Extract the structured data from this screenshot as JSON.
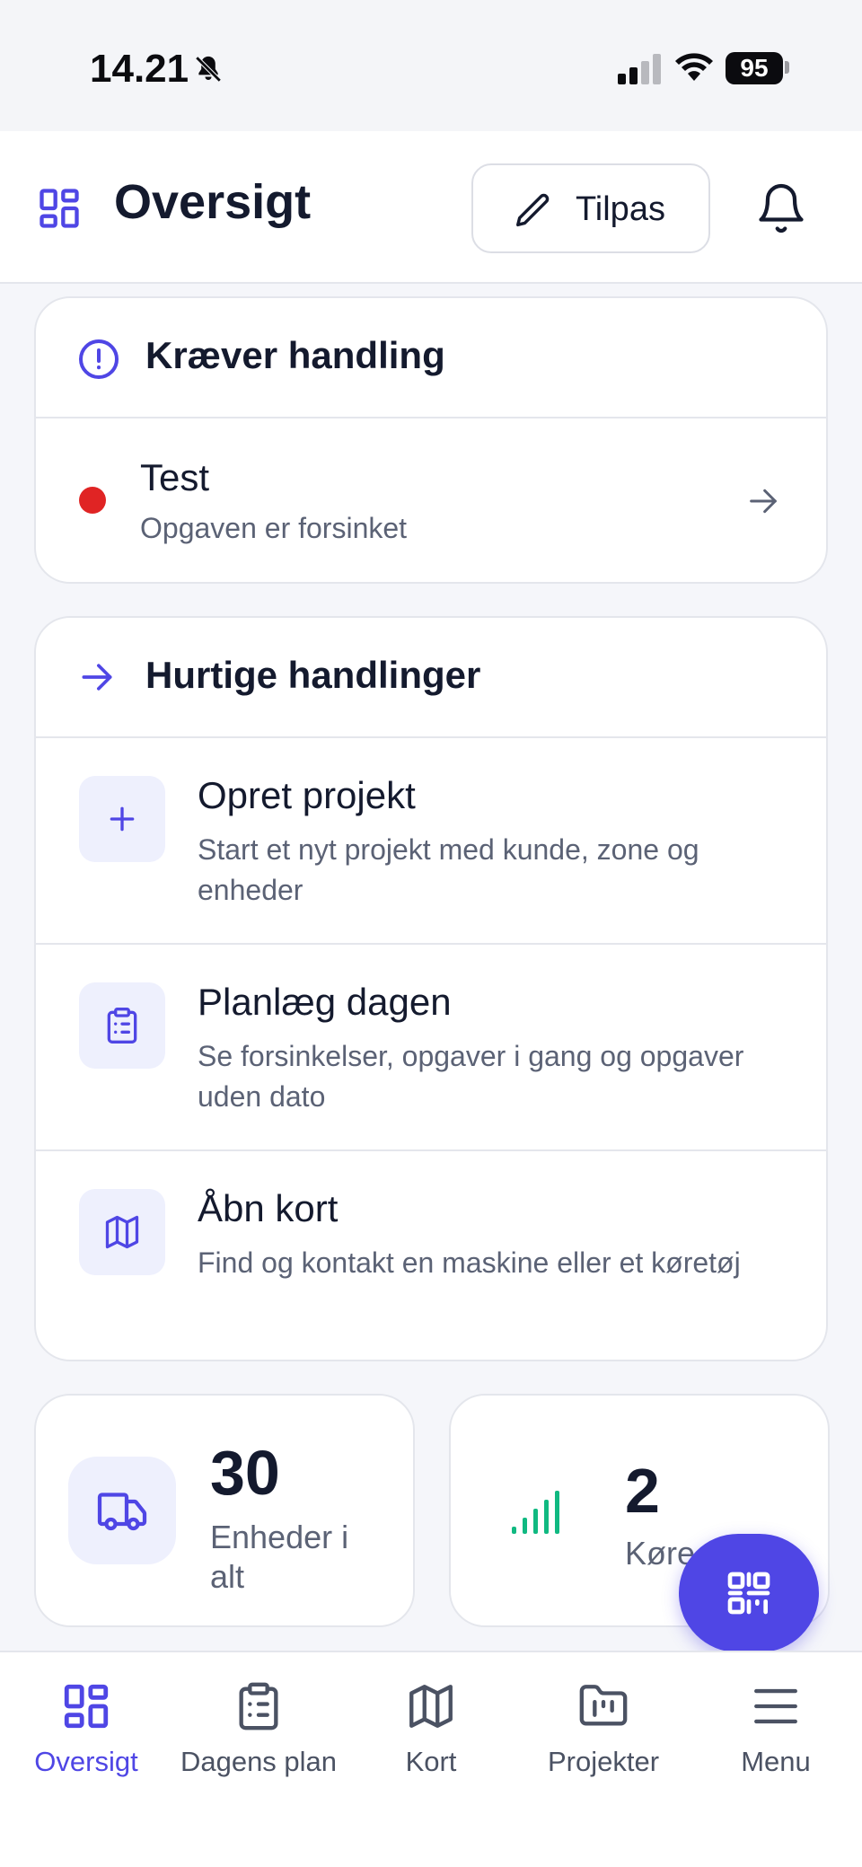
{
  "status_bar": {
    "time": "14.21",
    "battery": "95"
  },
  "header": {
    "title": "Oversigt",
    "customize_label": "Tilpas"
  },
  "action_required": {
    "title": "Kræver handling",
    "items": [
      {
        "name": "Test",
        "subtitle": "Opgaven er forsinket",
        "status_color": "#e02424"
      }
    ]
  },
  "quick_actions": {
    "title": "Hurtige handlinger",
    "items": [
      {
        "name": "Opret projekt",
        "subtitle": "Start et nyt projekt med kunde, zone og enheder"
      },
      {
        "name": "Planlæg dagen",
        "subtitle": "Se forsinkelser, opgaver i gang og opgaver uden dato"
      },
      {
        "name": "Åbn kort",
        "subtitle": "Find og kontakt en maskine eller et køretøj"
      }
    ]
  },
  "stats": [
    {
      "value": "30",
      "label": "Enheder i alt"
    },
    {
      "value": "2",
      "label": "Køre"
    }
  ],
  "tabs": [
    {
      "label": "Oversigt",
      "active": true
    },
    {
      "label": "Dagens plan",
      "active": false
    },
    {
      "label": "Kort",
      "active": false
    },
    {
      "label": "Projekter",
      "active": false
    },
    {
      "label": "Menu",
      "active": false
    }
  ],
  "colors": {
    "accent": "#4f46e5",
    "alert": "#e02424",
    "signal": "#10b981"
  }
}
